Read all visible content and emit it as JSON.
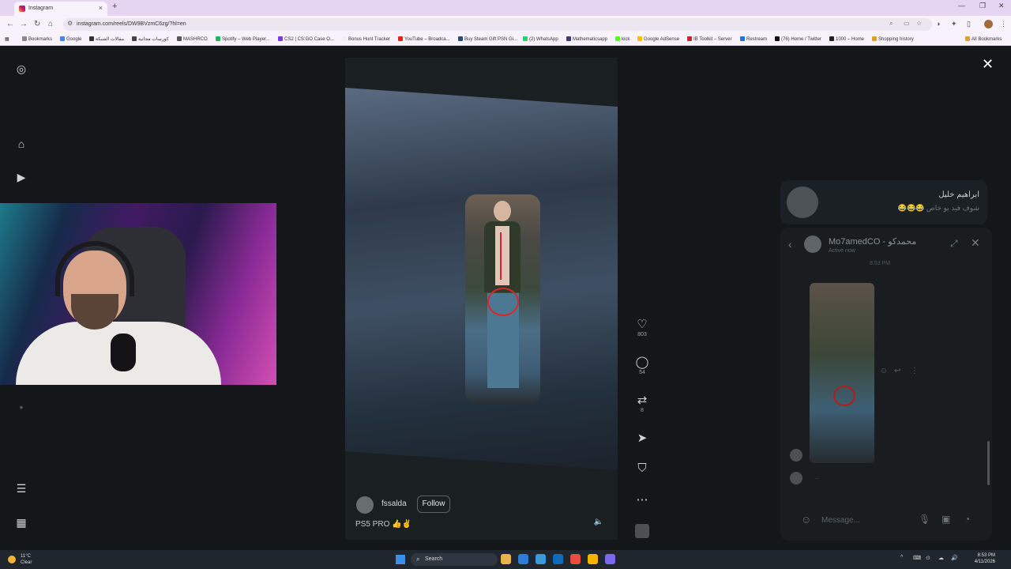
{
  "browser": {
    "tab_title": "Instagram",
    "tab_close": "×",
    "new_tab": "+",
    "url": "instagram.com/reels/DW9BVzmC6zg/?hl=en",
    "window_controls": [
      "—",
      "❐",
      "✕"
    ],
    "bookmarks": [
      {
        "label": "Bookmarks",
        "color": "#888888"
      },
      {
        "label": "Google",
        "color": "#4285f4"
      },
      {
        "label": "مقالات الشبكة",
        "color": "#333333"
      },
      {
        "label": "كورسات مجانية",
        "color": "#444444"
      },
      {
        "label": "MASHRCO",
        "color": "#555555"
      },
      {
        "label": "Spotify – Web Player...",
        "color": "#1db954"
      },
      {
        "label": "CS2 | CS:GO Case O...",
        "color": "#7a3bd6"
      },
      {
        "label": "Bonus Hunt Tracker",
        "color": "#f0f0f0"
      },
      {
        "label": "YouTube – Broadca...",
        "color": "#e62117"
      },
      {
        "label": "Buy Steam Gift PSN Gi...",
        "color": "#2a4a7a"
      },
      {
        "label": "(2) WhatsApp",
        "color": "#25d366"
      },
      {
        "label": "Mathematicsapp",
        "color": "#3b3b7a"
      },
      {
        "label": "kick",
        "color": "#53fc18"
      },
      {
        "label": "Google AdSense",
        "color": "#fbbc05"
      },
      {
        "label": "IB Toolkit – Server",
        "color": "#c62828"
      },
      {
        "label": "Restream",
        "color": "#1a73e8"
      },
      {
        "label": "(76) Home / Twitter",
        "color": "#111111"
      },
      {
        "label": "1000 – Home",
        "color": "#222222"
      },
      {
        "label": "Shopping history",
        "color": "#e0a030"
      }
    ],
    "all_bookmarks": "All Bookmarks"
  },
  "left_nav": {
    "items": [
      {
        "name": "instagram-logo-icon",
        "glyph": "◎"
      },
      {
        "name": "home-icon",
        "glyph": "⌂"
      },
      {
        "name": "reels-icon",
        "glyph": "▶"
      },
      {
        "name": "profile-dot-icon",
        "glyph": "•"
      },
      {
        "name": "menu-icon",
        "glyph": "☰"
      },
      {
        "name": "apps-grid-icon",
        "glyph": "▦"
      }
    ]
  },
  "reel": {
    "username": "fssalda",
    "follow_label": "Follow",
    "caption": "PS5 PRO 👍✌",
    "mute_glyph": "🔈"
  },
  "actions": {
    "like_count": "803",
    "comment_count": "54",
    "repost_count": "8",
    "like_glyph": "♡",
    "comment_glyph": "◯",
    "repost_glyph": "⇄",
    "share_glyph": "➤",
    "save_glyph": "⛉",
    "more_glyph": "⋯"
  },
  "close_glyph": "✕",
  "notification": {
    "name": "ابراهيم خليل",
    "message": "شوف فيد يو خاص 😂😂😂"
  },
  "chat": {
    "back_glyph": "‹",
    "name": "Mo7amedCO - محمدكو",
    "status": "Active now",
    "expand_glyph": "⤢",
    "close_glyph": "✕",
    "time": "8:53 PM",
    "react_glyph": "☺",
    "reply_glyph": "↩",
    "more_glyph": "⋮",
    "typing": "...",
    "emoji_glyph": "☺",
    "placeholder": "Message...",
    "mic_glyph": "🎙",
    "image_glyph": "▣",
    "sticker_glyph": "◔"
  },
  "taskbar": {
    "temperature": "11°C",
    "condition": "Clear",
    "search_glyph": "⌕",
    "search_label": "Search",
    "time": "8:53 PM",
    "date": "4/11/2026",
    "apps": [
      "#e8b44a",
      "#2f7bd6",
      "#3a9ad9",
      "#0f6cbd",
      "#e84d3d",
      "#f4b400",
      "#7b68ee"
    ],
    "tray_glyphs": [
      "^",
      "⌨",
      "⊙",
      "☁",
      "🔊"
    ]
  }
}
